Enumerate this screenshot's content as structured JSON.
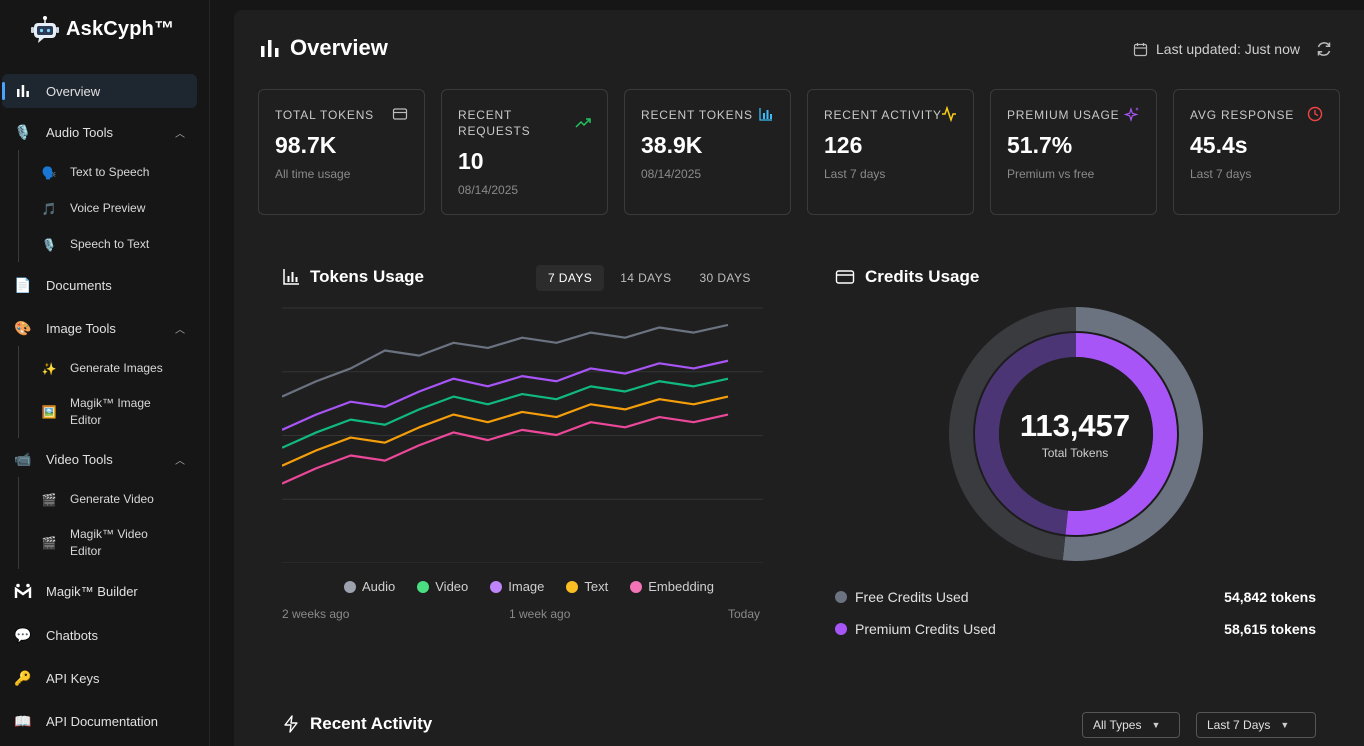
{
  "app": {
    "name": "AskCyph™"
  },
  "sidebar": {
    "items": [
      {
        "label": "Overview",
        "icon": "bar-chart-icon"
      },
      {
        "label": "Audio Tools",
        "icon": "microphone-icon"
      },
      {
        "label": "Text to Speech",
        "icon": "speaking-head-icon"
      },
      {
        "label": "Voice Preview",
        "icon": "music-note-icon"
      },
      {
        "label": "Speech to Text",
        "icon": "microphone-icon"
      },
      {
        "label": "Documents",
        "icon": "document-icon"
      },
      {
        "label": "Image Tools",
        "icon": "palette-icon"
      },
      {
        "label": "Generate Images",
        "icon": "sparkles-icon"
      },
      {
        "label": "Magik™ Image Editor",
        "icon": "image-edit-icon"
      },
      {
        "label": "Video Tools",
        "icon": "video-camera-icon"
      },
      {
        "label": "Generate Video",
        "icon": "clapper-icon"
      },
      {
        "label": "Magik™ Video Editor",
        "icon": "clapper-icon"
      },
      {
        "label": "Magik™ Builder",
        "icon": "magik-logo-icon"
      },
      {
        "label": "Chatbots",
        "icon": "speech-bubble-icon"
      },
      {
        "label": "API Keys",
        "icon": "key-icon"
      },
      {
        "label": "API Documentation",
        "icon": "book-icon"
      }
    ]
  },
  "header": {
    "title": "Overview",
    "updated": "Last updated: Just now"
  },
  "cards": [
    {
      "title": "TOTAL TOKENS",
      "value": "98.7K",
      "sub": "All time usage",
      "icon": "credit-card-icon",
      "icon_color": "#bdbdbd"
    },
    {
      "title": "RECENT REQUESTS",
      "value": "10",
      "sub": "08/14/2025",
      "icon": "trending-up-icon",
      "icon_color": "#22c55e"
    },
    {
      "title": "RECENT TOKENS",
      "value": "38.9K",
      "sub": "08/14/2025",
      "icon": "bar-chart-icon",
      "icon_color": "#38bdf8"
    },
    {
      "title": "RECENT ACTIVITY",
      "value": "126",
      "sub": "Last 7 days",
      "icon": "activity-icon",
      "icon_color": "#facc15"
    },
    {
      "title": "PREMIUM USAGE",
      "value": "51.7%",
      "sub": "Premium vs free",
      "icon": "sparkles-icon",
      "icon_color": "#a855f7"
    },
    {
      "title": "AVG RESPONSE",
      "value": "45.4s",
      "sub": "Last 7 days",
      "icon": "clock-icon",
      "icon_color": "#ef4444"
    }
  ],
  "tokens_usage": {
    "title": "Tokens Usage",
    "ranges": [
      "7 DAYS",
      "14 DAYS",
      "30 DAYS"
    ],
    "selected_range": "7 DAYS",
    "x_labels": [
      "2 weeks ago",
      "1 week ago",
      "Today"
    ]
  },
  "chart_data": [
    {
      "type": "line",
      "title": "Tokens Usage",
      "x": [
        1,
        2,
        3,
        4,
        5,
        6,
        7,
        8,
        9,
        10,
        11,
        12,
        13,
        14
      ],
      "ylim": [
        0,
        100
      ],
      "grid": true,
      "legend_position": "bottom",
      "series": [
        {
          "name": "Audio",
          "color": "#9ca3af",
          "line_color": "#6b7280",
          "values": [
            65,
            71,
            76,
            83,
            81,
            86,
            84,
            88,
            86,
            90,
            88,
            92,
            90,
            93
          ]
        },
        {
          "name": "Video",
          "color": "#4ade80",
          "line_color": "#10b981",
          "values": [
            45,
            51,
            56,
            54,
            60,
            65,
            62,
            66,
            64,
            69,
            67,
            71,
            69,
            72
          ]
        },
        {
          "name": "Image",
          "color": "#c084fc",
          "line_color": "#a855f7",
          "values": [
            52,
            58,
            63,
            61,
            67,
            72,
            69,
            73,
            71,
            76,
            74,
            78,
            76,
            79
          ]
        },
        {
          "name": "Text",
          "color": "#fbbf24",
          "line_color": "#f59e0b",
          "values": [
            38,
            44,
            49,
            47,
            53,
            58,
            55,
            59,
            57,
            62,
            60,
            64,
            62,
            65
          ]
        },
        {
          "name": "Embedding",
          "color": "#f472b6",
          "line_color": "#ec4899",
          "values": [
            31,
            37,
            42,
            40,
            46,
            51,
            48,
            52,
            50,
            55,
            53,
            57,
            55,
            58
          ]
        }
      ]
    },
    {
      "type": "pie",
      "title": "Credits Usage",
      "total": "113,457",
      "total_label": "Total Tokens",
      "slices": [
        {
          "name": "Free Credits Used",
          "value": 54842,
          "display": "54,842 tokens",
          "color": "#6b7280"
        },
        {
          "name": "Premium Credits Used",
          "value": 58615,
          "display": "58,615 tokens",
          "color": "#a855f7"
        }
      ]
    }
  ],
  "credits_usage": {
    "title": "Credits Usage"
  },
  "recent_activity": {
    "title": "Recent Activity",
    "type_filter": "All Types",
    "time_filter": "Last 7 Days"
  }
}
